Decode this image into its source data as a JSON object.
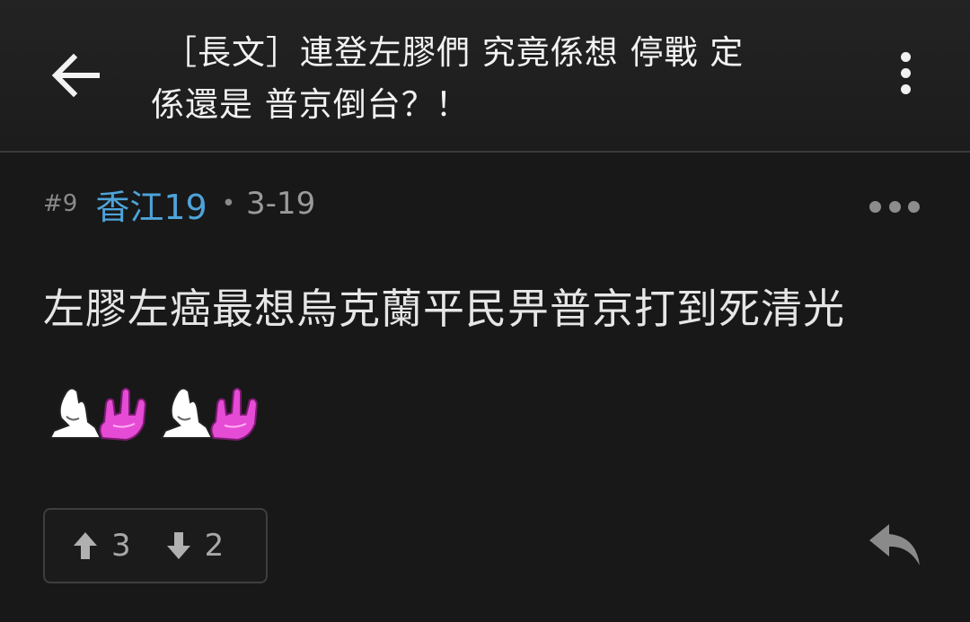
{
  "header": {
    "title_line1": "［長文］連登左膠們 究竟係想 停戰 定",
    "title_line2": "係還是 普京倒台？！"
  },
  "post": {
    "floor": "#9",
    "username": "香江19",
    "separator": "•",
    "date": "3-19",
    "content": "左膠左癌最想烏克蘭平民畀普京打到死清光"
  },
  "votes": {
    "up_count": "3",
    "down_count": "2"
  },
  "colors": {
    "background": "#181818",
    "username": "#4ea3d9",
    "meta": "#9a9a9a",
    "emoji_hand": "#e64bd6"
  },
  "icons": [
    "back-arrow-icon",
    "more-vertical-icon",
    "more-horizontal-icon",
    "upvote-icon",
    "downvote-icon",
    "reply-icon",
    "rock-hand-sticker"
  ]
}
